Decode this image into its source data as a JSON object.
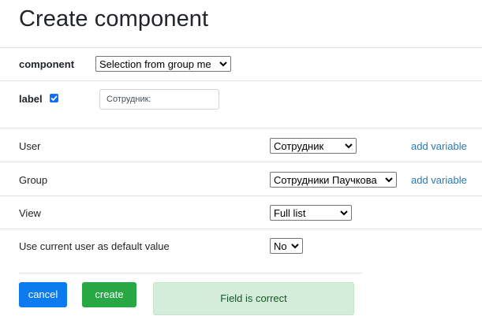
{
  "page": {
    "title": "Create component"
  },
  "form": {
    "component": {
      "label": "component",
      "value": "Selection from group me"
    },
    "label_row": {
      "label": "label",
      "checked": true,
      "input_value": "Сотрудник:"
    },
    "rows": [
      {
        "label": "User",
        "value": "Сотрудник",
        "link": "add variable"
      },
      {
        "label": "Group",
        "value": "Сотрудники Паучкова",
        "link": "add variable"
      },
      {
        "label": "View",
        "value": "Full list"
      },
      {
        "label": "Use current user as default value",
        "value": "No"
      }
    ]
  },
  "actions": {
    "cancel_label": "cancel",
    "create_label": "create"
  },
  "status": {
    "message": "Field is correct"
  },
  "colors": {
    "cancel_button": "#0d7bf0",
    "create_button": "#28a745",
    "success_bg": "#d4edda",
    "success_text": "#155724",
    "link": "#2a7ab0",
    "checkbox": "#0d6efd"
  },
  "icons": {
    "select_arrow": "chevron-down-icon",
    "checkbox_check": "check-icon"
  }
}
